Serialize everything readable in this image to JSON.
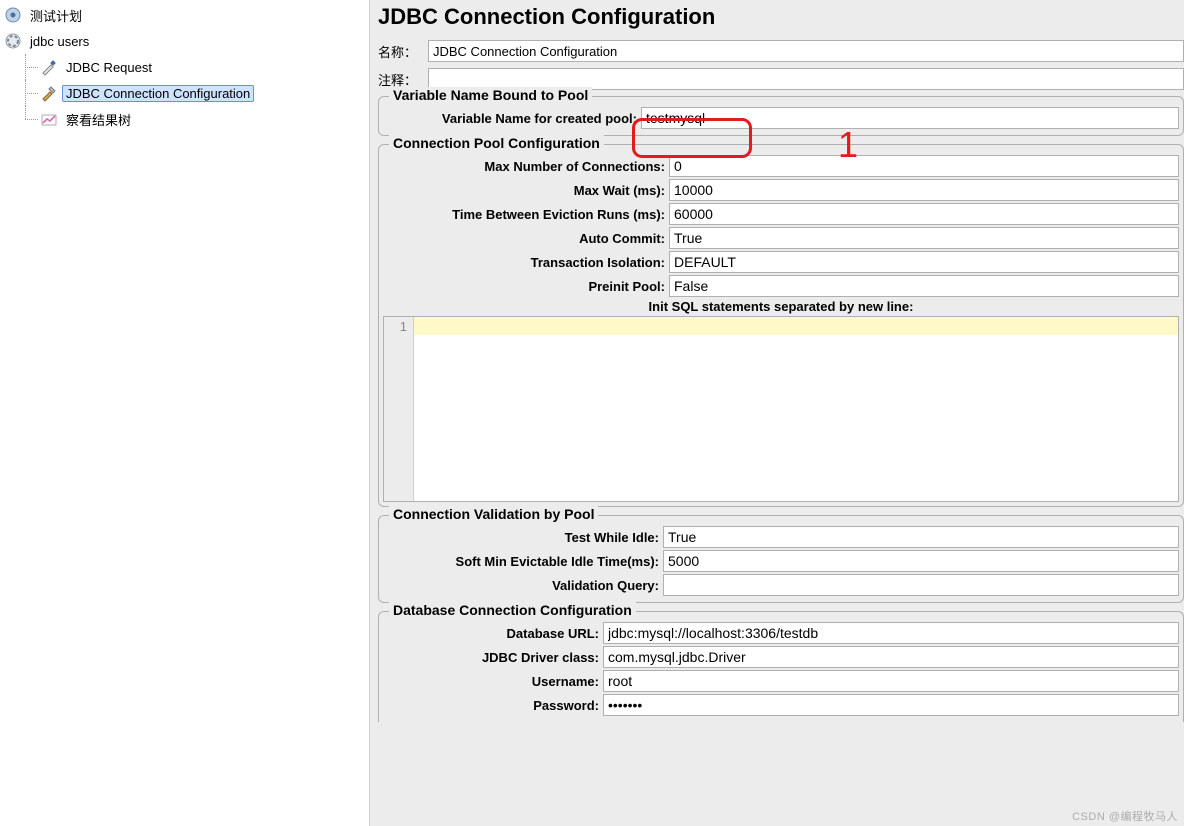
{
  "tree": {
    "root": "测试计划",
    "group": "jdbc users",
    "items": [
      "JDBC Request",
      "JDBC Connection Configuration",
      "察看结果树"
    ],
    "selected_index": 1
  },
  "header": {
    "title": "JDBC Connection Configuration",
    "name_label": "名称：",
    "name_value": "JDBC Connection Configuration",
    "comment_label": "注释：",
    "comment_value": ""
  },
  "var_pool": {
    "legend": "Variable Name Bound to Pool",
    "k": "Variable Name for created pool:",
    "v": "testmysql"
  },
  "conn_pool": {
    "legend": "Connection Pool Configuration",
    "rows": [
      {
        "k": "Max Number of Connections:",
        "v": "0"
      },
      {
        "k": "Max Wait (ms):",
        "v": "10000"
      },
      {
        "k": "Time Between Eviction Runs (ms):",
        "v": "60000"
      },
      {
        "k": "Auto Commit:",
        "v": "True"
      },
      {
        "k": "Transaction Isolation:",
        "v": "DEFAULT"
      },
      {
        "k": "Preinit Pool:",
        "v": "False"
      }
    ],
    "init_header": "Init SQL statements separated by new line:",
    "editor_line": "1"
  },
  "validation": {
    "legend": "Connection Validation by Pool",
    "rows": [
      {
        "k": "Test While Idle:",
        "v": "True"
      },
      {
        "k": "Soft Min Evictable Idle Time(ms):",
        "v": "5000"
      },
      {
        "k": "Validation Query:",
        "v": ""
      }
    ]
  },
  "db": {
    "legend": "Database Connection Configuration",
    "rows": [
      {
        "k": "Database URL:",
        "v": "jdbc:mysql://localhost:3306/testdb"
      },
      {
        "k": "JDBC Driver class:",
        "v": "com.mysql.jdbc.Driver"
      },
      {
        "k": "Username:",
        "v": "root"
      },
      {
        "k": "Password:",
        "v": "•••••••"
      }
    ]
  },
  "annotation": {
    "num": "1"
  },
  "watermark": "CSDN @编程牧马人"
}
